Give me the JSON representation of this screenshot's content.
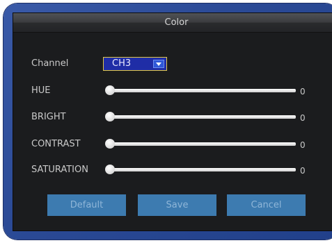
{
  "dialog": {
    "title": "Color"
  },
  "channel": {
    "label": "Channel",
    "selected": "CH3"
  },
  "sliders": [
    {
      "label": "HUE",
      "value": "0",
      "level": 0
    },
    {
      "label": "BRIGHT",
      "value": "0",
      "level": 0
    },
    {
      "label": "CONTRAST",
      "value": "0",
      "level": 0
    },
    {
      "label": "SATURATION",
      "value": "0",
      "level": 0
    }
  ],
  "buttons": {
    "default_label": "Default",
    "save_label": "Save",
    "cancel_label": "Cancel"
  },
  "colors": {
    "frame": "#2b4a96",
    "panel": "#1b1c1e",
    "select_bg": "#1f2da6",
    "select_border": "#e2c84a",
    "button": "#3d7bb0"
  }
}
